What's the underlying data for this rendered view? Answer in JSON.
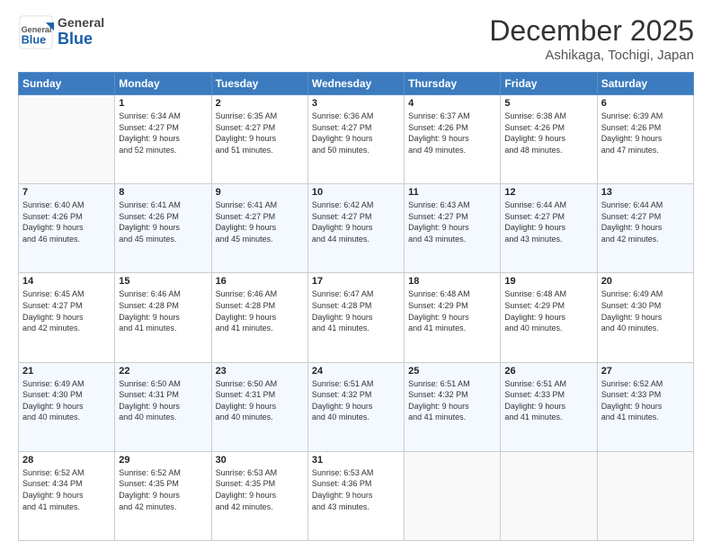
{
  "header": {
    "logo_general": "General",
    "logo_blue": "Blue",
    "month_title": "December 2025",
    "location": "Ashikaga, Tochigi, Japan"
  },
  "days_of_week": [
    "Sunday",
    "Monday",
    "Tuesday",
    "Wednesday",
    "Thursday",
    "Friday",
    "Saturday"
  ],
  "weeks": [
    [
      {
        "day": "",
        "info": ""
      },
      {
        "day": "1",
        "info": "Sunrise: 6:34 AM\nSunset: 4:27 PM\nDaylight: 9 hours\nand 52 minutes."
      },
      {
        "day": "2",
        "info": "Sunrise: 6:35 AM\nSunset: 4:27 PM\nDaylight: 9 hours\nand 51 minutes."
      },
      {
        "day": "3",
        "info": "Sunrise: 6:36 AM\nSunset: 4:27 PM\nDaylight: 9 hours\nand 50 minutes."
      },
      {
        "day": "4",
        "info": "Sunrise: 6:37 AM\nSunset: 4:26 PM\nDaylight: 9 hours\nand 49 minutes."
      },
      {
        "day": "5",
        "info": "Sunrise: 6:38 AM\nSunset: 4:26 PM\nDaylight: 9 hours\nand 48 minutes."
      },
      {
        "day": "6",
        "info": "Sunrise: 6:39 AM\nSunset: 4:26 PM\nDaylight: 9 hours\nand 47 minutes."
      }
    ],
    [
      {
        "day": "7",
        "info": "Sunrise: 6:40 AM\nSunset: 4:26 PM\nDaylight: 9 hours\nand 46 minutes."
      },
      {
        "day": "8",
        "info": "Sunrise: 6:41 AM\nSunset: 4:26 PM\nDaylight: 9 hours\nand 45 minutes."
      },
      {
        "day": "9",
        "info": "Sunrise: 6:41 AM\nSunset: 4:27 PM\nDaylight: 9 hours\nand 45 minutes."
      },
      {
        "day": "10",
        "info": "Sunrise: 6:42 AM\nSunset: 4:27 PM\nDaylight: 9 hours\nand 44 minutes."
      },
      {
        "day": "11",
        "info": "Sunrise: 6:43 AM\nSunset: 4:27 PM\nDaylight: 9 hours\nand 43 minutes."
      },
      {
        "day": "12",
        "info": "Sunrise: 6:44 AM\nSunset: 4:27 PM\nDaylight: 9 hours\nand 43 minutes."
      },
      {
        "day": "13",
        "info": "Sunrise: 6:44 AM\nSunset: 4:27 PM\nDaylight: 9 hours\nand 42 minutes."
      }
    ],
    [
      {
        "day": "14",
        "info": "Sunrise: 6:45 AM\nSunset: 4:27 PM\nDaylight: 9 hours\nand 42 minutes."
      },
      {
        "day": "15",
        "info": "Sunrise: 6:46 AM\nSunset: 4:28 PM\nDaylight: 9 hours\nand 41 minutes."
      },
      {
        "day": "16",
        "info": "Sunrise: 6:46 AM\nSunset: 4:28 PM\nDaylight: 9 hours\nand 41 minutes."
      },
      {
        "day": "17",
        "info": "Sunrise: 6:47 AM\nSunset: 4:28 PM\nDaylight: 9 hours\nand 41 minutes."
      },
      {
        "day": "18",
        "info": "Sunrise: 6:48 AM\nSunset: 4:29 PM\nDaylight: 9 hours\nand 41 minutes."
      },
      {
        "day": "19",
        "info": "Sunrise: 6:48 AM\nSunset: 4:29 PM\nDaylight: 9 hours\nand 40 minutes."
      },
      {
        "day": "20",
        "info": "Sunrise: 6:49 AM\nSunset: 4:30 PM\nDaylight: 9 hours\nand 40 minutes."
      }
    ],
    [
      {
        "day": "21",
        "info": "Sunrise: 6:49 AM\nSunset: 4:30 PM\nDaylight: 9 hours\nand 40 minutes."
      },
      {
        "day": "22",
        "info": "Sunrise: 6:50 AM\nSunset: 4:31 PM\nDaylight: 9 hours\nand 40 minutes."
      },
      {
        "day": "23",
        "info": "Sunrise: 6:50 AM\nSunset: 4:31 PM\nDaylight: 9 hours\nand 40 minutes."
      },
      {
        "day": "24",
        "info": "Sunrise: 6:51 AM\nSunset: 4:32 PM\nDaylight: 9 hours\nand 40 minutes."
      },
      {
        "day": "25",
        "info": "Sunrise: 6:51 AM\nSunset: 4:32 PM\nDaylight: 9 hours\nand 41 minutes."
      },
      {
        "day": "26",
        "info": "Sunrise: 6:51 AM\nSunset: 4:33 PM\nDaylight: 9 hours\nand 41 minutes."
      },
      {
        "day": "27",
        "info": "Sunrise: 6:52 AM\nSunset: 4:33 PM\nDaylight: 9 hours\nand 41 minutes."
      }
    ],
    [
      {
        "day": "28",
        "info": "Sunrise: 6:52 AM\nSunset: 4:34 PM\nDaylight: 9 hours\nand 41 minutes."
      },
      {
        "day": "29",
        "info": "Sunrise: 6:52 AM\nSunset: 4:35 PM\nDaylight: 9 hours\nand 42 minutes."
      },
      {
        "day": "30",
        "info": "Sunrise: 6:53 AM\nSunset: 4:35 PM\nDaylight: 9 hours\nand 42 minutes."
      },
      {
        "day": "31",
        "info": "Sunrise: 6:53 AM\nSunset: 4:36 PM\nDaylight: 9 hours\nand 43 minutes."
      },
      {
        "day": "",
        "info": ""
      },
      {
        "day": "",
        "info": ""
      },
      {
        "day": "",
        "info": ""
      }
    ]
  ]
}
